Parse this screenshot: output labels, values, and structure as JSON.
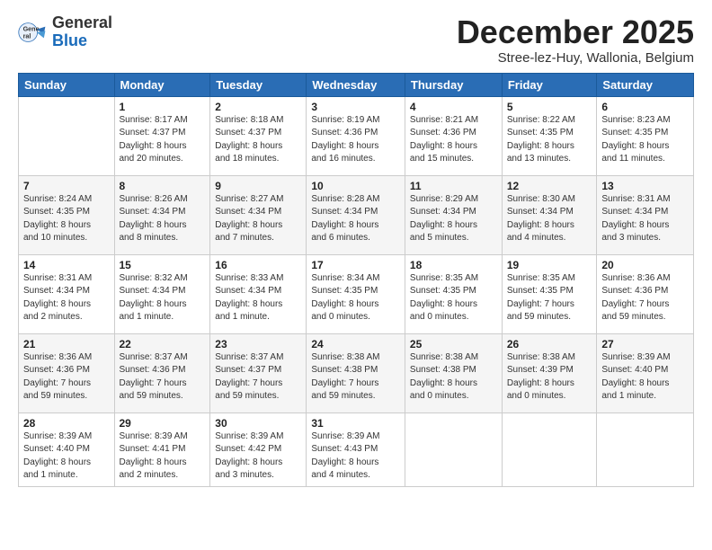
{
  "header": {
    "logo_general": "General",
    "logo_blue": "Blue",
    "month": "December 2025",
    "location": "Stree-lez-Huy, Wallonia, Belgium"
  },
  "weekdays": [
    "Sunday",
    "Monday",
    "Tuesday",
    "Wednesday",
    "Thursday",
    "Friday",
    "Saturday"
  ],
  "weeks": [
    [
      {
        "day": "",
        "info": ""
      },
      {
        "day": "1",
        "info": "Sunrise: 8:17 AM\nSunset: 4:37 PM\nDaylight: 8 hours\nand 20 minutes."
      },
      {
        "day": "2",
        "info": "Sunrise: 8:18 AM\nSunset: 4:37 PM\nDaylight: 8 hours\nand 18 minutes."
      },
      {
        "day": "3",
        "info": "Sunrise: 8:19 AM\nSunset: 4:36 PM\nDaylight: 8 hours\nand 16 minutes."
      },
      {
        "day": "4",
        "info": "Sunrise: 8:21 AM\nSunset: 4:36 PM\nDaylight: 8 hours\nand 15 minutes."
      },
      {
        "day": "5",
        "info": "Sunrise: 8:22 AM\nSunset: 4:35 PM\nDaylight: 8 hours\nand 13 minutes."
      },
      {
        "day": "6",
        "info": "Sunrise: 8:23 AM\nSunset: 4:35 PM\nDaylight: 8 hours\nand 11 minutes."
      }
    ],
    [
      {
        "day": "7",
        "info": "Sunrise: 8:24 AM\nSunset: 4:35 PM\nDaylight: 8 hours\nand 10 minutes."
      },
      {
        "day": "8",
        "info": "Sunrise: 8:26 AM\nSunset: 4:34 PM\nDaylight: 8 hours\nand 8 minutes."
      },
      {
        "day": "9",
        "info": "Sunrise: 8:27 AM\nSunset: 4:34 PM\nDaylight: 8 hours\nand 7 minutes."
      },
      {
        "day": "10",
        "info": "Sunrise: 8:28 AM\nSunset: 4:34 PM\nDaylight: 8 hours\nand 6 minutes."
      },
      {
        "day": "11",
        "info": "Sunrise: 8:29 AM\nSunset: 4:34 PM\nDaylight: 8 hours\nand 5 minutes."
      },
      {
        "day": "12",
        "info": "Sunrise: 8:30 AM\nSunset: 4:34 PM\nDaylight: 8 hours\nand 4 minutes."
      },
      {
        "day": "13",
        "info": "Sunrise: 8:31 AM\nSunset: 4:34 PM\nDaylight: 8 hours\nand 3 minutes."
      }
    ],
    [
      {
        "day": "14",
        "info": "Sunrise: 8:31 AM\nSunset: 4:34 PM\nDaylight: 8 hours\nand 2 minutes."
      },
      {
        "day": "15",
        "info": "Sunrise: 8:32 AM\nSunset: 4:34 PM\nDaylight: 8 hours\nand 1 minute."
      },
      {
        "day": "16",
        "info": "Sunrise: 8:33 AM\nSunset: 4:34 PM\nDaylight: 8 hours\nand 1 minute."
      },
      {
        "day": "17",
        "info": "Sunrise: 8:34 AM\nSunset: 4:35 PM\nDaylight: 8 hours\nand 0 minutes."
      },
      {
        "day": "18",
        "info": "Sunrise: 8:35 AM\nSunset: 4:35 PM\nDaylight: 8 hours\nand 0 minutes."
      },
      {
        "day": "19",
        "info": "Sunrise: 8:35 AM\nSunset: 4:35 PM\nDaylight: 7 hours\nand 59 minutes."
      },
      {
        "day": "20",
        "info": "Sunrise: 8:36 AM\nSunset: 4:36 PM\nDaylight: 7 hours\nand 59 minutes."
      }
    ],
    [
      {
        "day": "21",
        "info": "Sunrise: 8:36 AM\nSunset: 4:36 PM\nDaylight: 7 hours\nand 59 minutes."
      },
      {
        "day": "22",
        "info": "Sunrise: 8:37 AM\nSunset: 4:36 PM\nDaylight: 7 hours\nand 59 minutes."
      },
      {
        "day": "23",
        "info": "Sunrise: 8:37 AM\nSunset: 4:37 PM\nDaylight: 7 hours\nand 59 minutes."
      },
      {
        "day": "24",
        "info": "Sunrise: 8:38 AM\nSunset: 4:38 PM\nDaylight: 7 hours\nand 59 minutes."
      },
      {
        "day": "25",
        "info": "Sunrise: 8:38 AM\nSunset: 4:38 PM\nDaylight: 8 hours\nand 0 minutes."
      },
      {
        "day": "26",
        "info": "Sunrise: 8:38 AM\nSunset: 4:39 PM\nDaylight: 8 hours\nand 0 minutes."
      },
      {
        "day": "27",
        "info": "Sunrise: 8:39 AM\nSunset: 4:40 PM\nDaylight: 8 hours\nand 1 minute."
      }
    ],
    [
      {
        "day": "28",
        "info": "Sunrise: 8:39 AM\nSunset: 4:40 PM\nDaylight: 8 hours\nand 1 minute."
      },
      {
        "day": "29",
        "info": "Sunrise: 8:39 AM\nSunset: 4:41 PM\nDaylight: 8 hours\nand 2 minutes."
      },
      {
        "day": "30",
        "info": "Sunrise: 8:39 AM\nSunset: 4:42 PM\nDaylight: 8 hours\nand 3 minutes."
      },
      {
        "day": "31",
        "info": "Sunrise: 8:39 AM\nSunset: 4:43 PM\nDaylight: 8 hours\nand 4 minutes."
      },
      {
        "day": "",
        "info": ""
      },
      {
        "day": "",
        "info": ""
      },
      {
        "day": "",
        "info": ""
      }
    ]
  ]
}
